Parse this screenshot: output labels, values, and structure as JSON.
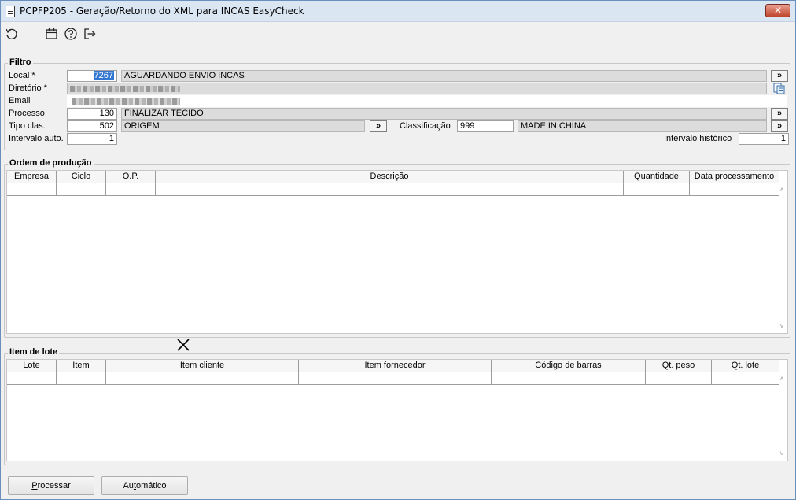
{
  "window": {
    "title": "PCPFP205 - Geração/Retorno do XML para INCAS EasyCheck",
    "close_label": "✕"
  },
  "toolbar": {
    "icons": [
      "refresh-icon",
      "calendar-icon",
      "help-icon",
      "exit-icon"
    ]
  },
  "filtro": {
    "title": "Filtro",
    "local_label": "Local *",
    "local_value": "7267",
    "local_desc": "AGUARDANDO ENVIO INCAS",
    "diretorio_label": "Diretório *",
    "email_label": "Email",
    "processo_label": "Processo",
    "processo_value": "130",
    "processo_desc": "FINALIZAR TECIDO",
    "tipo_label": "Tipo clas.",
    "tipo_value": "502",
    "tipo_desc": "ORIGEM",
    "classificacao_label": "Classificação",
    "classificacao_value": "999",
    "classificacao_desc": "MADE IN CHINA",
    "intervalo_auto_label": "Intervalo auto.",
    "intervalo_auto_value": "1",
    "intervalo_hist_label": "Intervalo histórico",
    "intervalo_hist_value": "1",
    "more_label": "»"
  },
  "ordem": {
    "title": "Ordem de produção",
    "columns": [
      "Empresa",
      "Ciclo",
      "O.P.",
      "Descrição",
      "Quantidade",
      "Data processamento"
    ]
  },
  "item": {
    "title": "Item de lote",
    "columns": [
      "Lote",
      "Item",
      "Item cliente",
      "Item fornecedor",
      "Código de barras",
      "Qt. peso",
      "Qt. lote"
    ]
  },
  "buttons": {
    "processar_prefix": "P",
    "processar_rest": "rocessar",
    "automatico_prefix": "Au",
    "automatico_u": "t",
    "automatico_rest": "omático"
  },
  "colors": {
    "selection": "#3277d1",
    "title_bg": "#dbe6f3",
    "close": "#c0442c"
  }
}
